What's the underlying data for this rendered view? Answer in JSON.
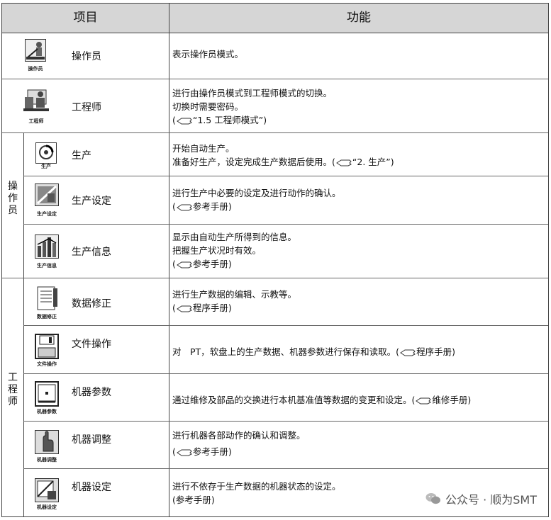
{
  "header": {
    "col_item": "项目",
    "col_function": "功能"
  },
  "groups": {
    "operator": "操作员",
    "engineer": "工程师"
  },
  "rows": [
    {
      "icon_label": "操作员",
      "name": "操作员",
      "lines": [
        "表示操作员模式。"
      ]
    },
    {
      "icon_label": "工程师",
      "name": "工程师",
      "lines": [
        "进行由操作员模式到工程师模式的切换。",
        "切换时需要密码。",
        "“1.5 工程师模式”)"
      ]
    },
    {
      "icon_label": "生产",
      "name": "生产",
      "lines": [
        "开始自动生产。",
        "准备好生产，设定完成生产数据后使用。(",
        "“2. 生产”)"
      ]
    },
    {
      "icon_label": "生产设定",
      "name": "生产设定",
      "lines": [
        "进行生产中必要的设定及进行动作的确认。",
        "参考手册)"
      ]
    },
    {
      "icon_label": "生产信息",
      "name": "生产信息",
      "lines": [
        "显示由自动生产所得到的信息。",
        "把握生产状况时有效。",
        "参考手册)"
      ]
    },
    {
      "icon_label": "数据修正",
      "name": "数据修正",
      "lines": [
        "进行生产数据的编辑、示教等。",
        "程序手册)"
      ]
    },
    {
      "icon_label": "文件操作",
      "name": "文件操作",
      "lines": [
        "对　PT，软盘上的生产数据、机器参数进行保存和读取。(",
        "程序手册)"
      ]
    },
    {
      "icon_label": "机器参数",
      "name": "机器参数",
      "lines": [
        "通过维修及部品的交换进行本机基准值等数据的变更和设定。(",
        "维修手册)"
      ]
    },
    {
      "icon_label": "机器调整",
      "name": "机器调整",
      "lines": [
        "进行机器各部动作的确认和调整。",
        "参考手册)"
      ]
    },
    {
      "icon_label": "机器设定",
      "name": "机器设定",
      "lines": [
        "进行不依存于生产数据的机器状态的设定。",
        "(参考手册)"
      ]
    }
  ],
  "watermark": {
    "text": "公众号 · 顺为SMT"
  },
  "colors": {
    "header_bg": "#d6d6d6",
    "border": "#444444"
  }
}
